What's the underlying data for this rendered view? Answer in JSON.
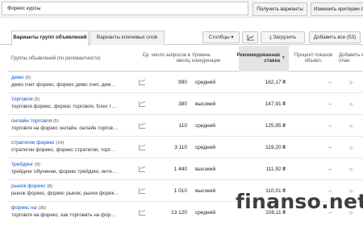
{
  "toolbar": {
    "search_value": "Форекс курсы",
    "get_variants": "Получить варианты",
    "change_criteria": "Изменить критерии п"
  },
  "tabs": {
    "groups": "Варианты групп объявлений",
    "keywords": "Варианты ключевых слов",
    "columns": "Столбцы ▾",
    "download": "Загрузить",
    "add_all": "Добавить все (53)"
  },
  "headers": {
    "group": "Группы объявлений (по релевантности)",
    "searches": "Ср. число запросов в месяц",
    "competition": "Уровень конкуренции",
    "bid": "Рекомендованная ставка",
    "impressions": "Процент показов объявл.",
    "add": "Добавить в план"
  },
  "rows": [
    {
      "name": "демо",
      "count": "(6)",
      "keywords": "демо счет форекс, форекс демо счет, дем…",
      "searches": "990",
      "competition": "средний",
      "bid": "162,17 ₴",
      "impr": "–",
      "add": "»"
    },
    {
      "name": "торговля",
      "count": "(5)",
      "keywords": "торговля форекс, форекс торговля, forex т…",
      "searches": "380",
      "competition": "высокий",
      "bid": "147,91 ₴",
      "impr": "–",
      "add": "»"
    },
    {
      "name": "онлайн торговля",
      "count": "(5)",
      "keywords": "торговля на форекс онлайн, онлайн торгов…",
      "searches": "110",
      "competition": "средний",
      "bid": "125,95 ₴",
      "impr": "–",
      "add": "»"
    },
    {
      "name": "стратегии форекс",
      "count": "(14)",
      "keywords": "стратегии форекс, форекс стратегии, торг…",
      "searches": "3 110",
      "competition": "средний",
      "bid": "119,20 ₴",
      "impr": "–",
      "add": "»"
    },
    {
      "name": "трейдинг",
      "count": "(9)",
      "keywords": "трейдинг обучение, форекс трейдинг, инте…",
      "searches": "1 440",
      "competition": "высокий",
      "bid": "111,92 ₴",
      "impr": "–",
      "add": "»"
    },
    {
      "name": "рынок форекс",
      "count": "(8)",
      "keywords": "рынок форекс, форекс рынок, рынок форек…",
      "searches": "1 010",
      "competition": "высокий",
      "bid": "110,01 ₴",
      "impr": "–",
      "add": "»"
    },
    {
      "name": "форекс на",
      "count": "(36)",
      "keywords": "торговля на форекс, как торговать на фор…",
      "searches": "13 120",
      "competition": "средний",
      "bid": "108,11 ₴",
      "impr": "–",
      "add": "»"
    }
  ],
  "watermark": "finanso.net"
}
